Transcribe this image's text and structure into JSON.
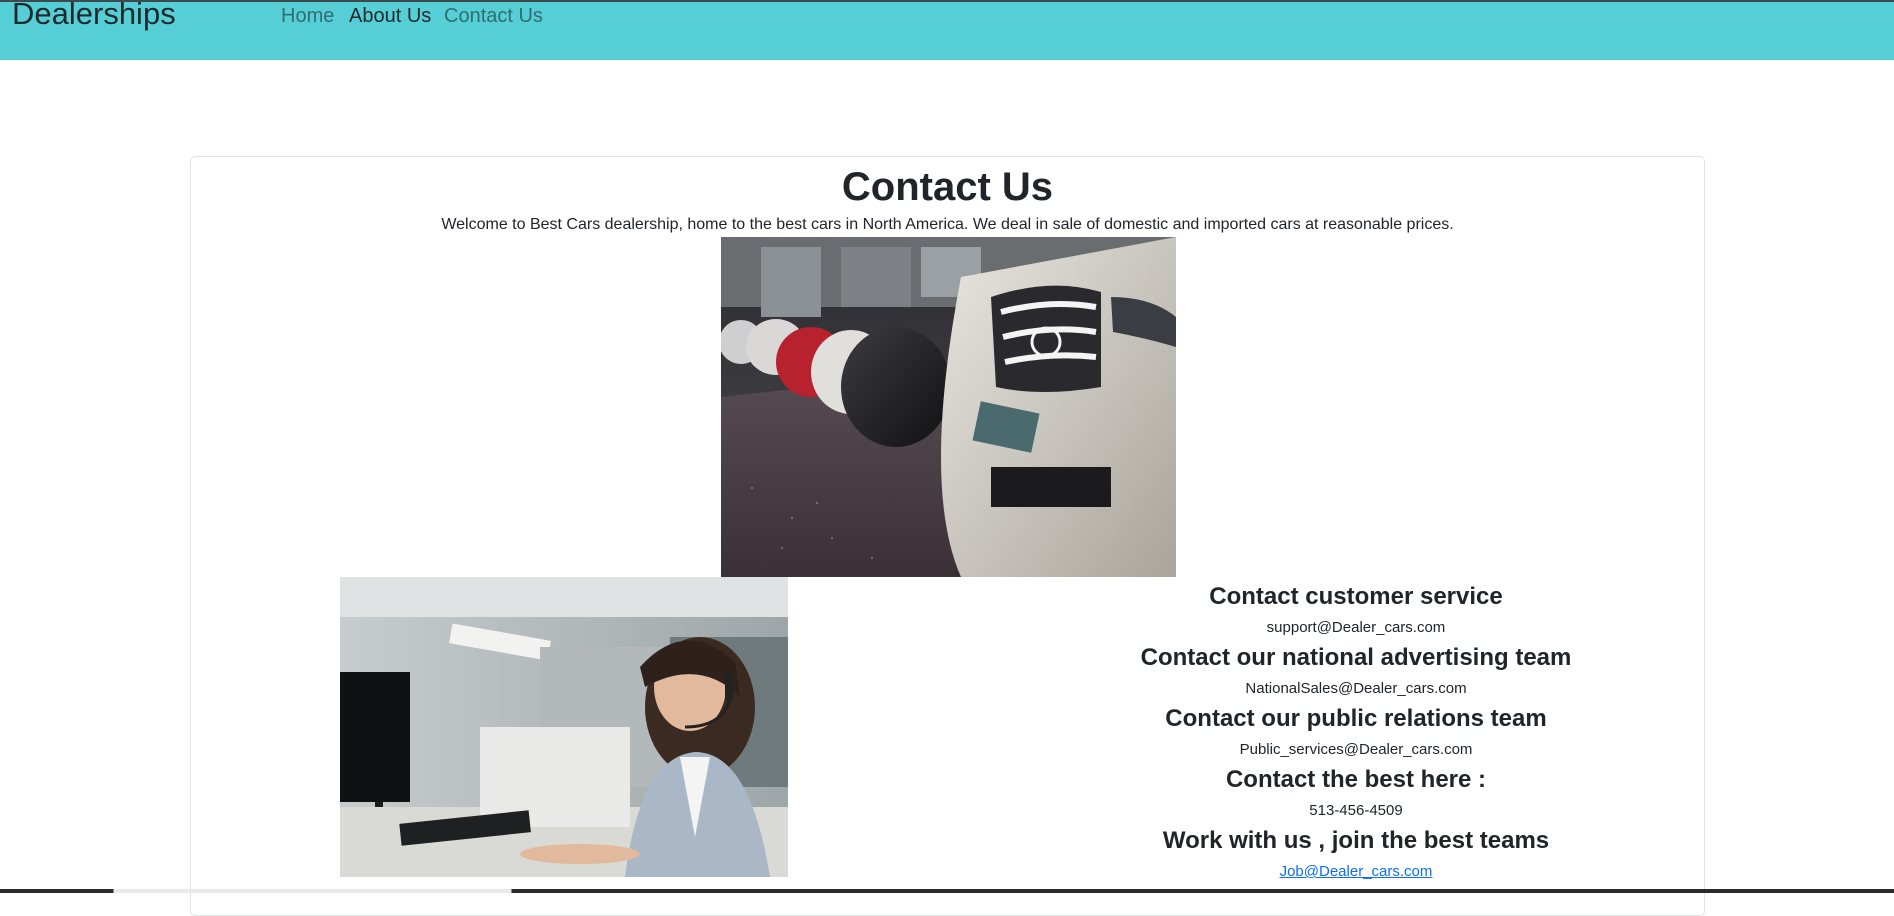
{
  "navbar": {
    "brand": "Dealerships",
    "links": [
      {
        "label": "Home"
      },
      {
        "label": "About Us"
      },
      {
        "label": "Contact Us"
      }
    ],
    "background": "#56ced6"
  },
  "main": {
    "title": "Contact Us",
    "intro": "Welcome to Best Cars dealership, home to the best cars in North America. We deal in sale of domestic and imported cars at reasonable prices."
  },
  "contacts": [
    {
      "heading": "Contact customer service",
      "value": "support@Dealer_cars.com"
    },
    {
      "heading": "Contact our national advertising team",
      "value": "NationalSales@Dealer_cars.com"
    },
    {
      "heading": "Contact our public relations team",
      "value": "Public_services@Dealer_cars.com"
    },
    {
      "heading": "Contact the best here :",
      "value": "513-456-4509"
    },
    {
      "heading": "Work with us , join the best teams",
      "value": "Job@Dealer_cars.com"
    }
  ]
}
